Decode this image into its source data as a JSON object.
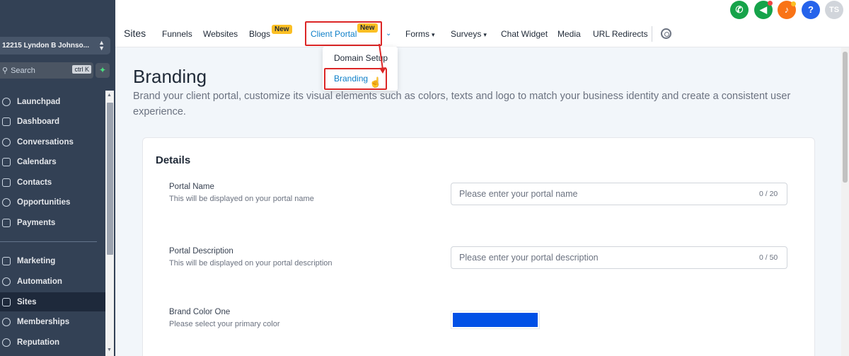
{
  "sidebar": {
    "location": "12215 Lyndon B Johnso...",
    "search_placeholder": "Search",
    "search_shortcut": "ctrl K",
    "items": [
      {
        "label": "Launchpad"
      },
      {
        "label": "Dashboard"
      },
      {
        "label": "Conversations"
      },
      {
        "label": "Calendars"
      },
      {
        "label": "Contacts"
      },
      {
        "label": "Opportunities"
      },
      {
        "label": "Payments"
      },
      {
        "label": "Marketing"
      },
      {
        "label": "Automation"
      },
      {
        "label": "Sites",
        "active": true
      },
      {
        "label": "Memberships"
      },
      {
        "label": "Reputation"
      }
    ]
  },
  "topnav": {
    "section": "Sites",
    "tabs": [
      {
        "label": "Funnels"
      },
      {
        "label": "Websites"
      },
      {
        "label": "Blogs",
        "badge": "New"
      },
      {
        "label": "Client Portal",
        "badge": "New",
        "active": true
      },
      {
        "label": "Forms"
      },
      {
        "label": "Surveys"
      },
      {
        "label": "Chat Widget"
      },
      {
        "label": "Media"
      },
      {
        "label": "URL Redirects"
      }
    ],
    "avatar_initials": "TS",
    "help_glyph": "?",
    "icon_colors": {
      "phone": "#16a34a",
      "megaphone": "#16a34a",
      "bell": "#f97316",
      "help": "#2563eb",
      "avatar": "#d1d5db"
    }
  },
  "dropdown": {
    "items": [
      "Domain Setup",
      "Branding"
    ]
  },
  "page": {
    "title": "Branding",
    "description": "Brand your client portal, customize its visual elements such as colors, texts and logo to match your business identity and create a consistent user experience."
  },
  "details": {
    "title": "Details",
    "fields": [
      {
        "label": "Portal Name",
        "help": "This will be displayed on your portal name",
        "placeholder": "Please enter your portal name",
        "counter": "0 / 20"
      },
      {
        "label": "Portal Description",
        "help": "This will be displayed on your portal description",
        "placeholder": "Please enter your portal description",
        "counter": "0 / 50"
      },
      {
        "label": "Brand Color One",
        "help": "Please select your primary color",
        "color": "#0050e6"
      }
    ]
  },
  "colors": {
    "accent": "#0e7fc8",
    "highlight": "#dc2626",
    "badge": "#fbbf24"
  }
}
